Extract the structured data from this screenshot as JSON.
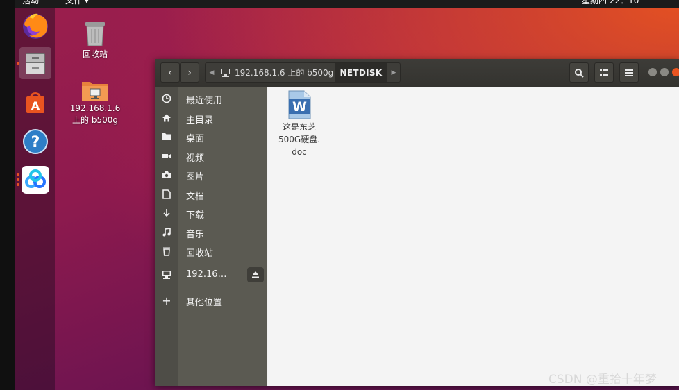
{
  "topbar": {
    "activities": "活动",
    "file_menu": "文件 ▾",
    "clock": "星期四 22：10"
  },
  "dock": {
    "items": [
      {
        "icon": "firefox-icon"
      },
      {
        "icon": "files-icon"
      },
      {
        "icon": "software-store-icon"
      },
      {
        "icon": "help-icon"
      },
      {
        "icon": "baidu-netdisk-icon"
      }
    ]
  },
  "desktop": {
    "icons": [
      {
        "label": "回收站",
        "icon": "trash-icon"
      },
      {
        "label_line1": "192.168.1.6",
        "label_line2": "上的 b500g",
        "icon": "network-folder-icon"
      }
    ]
  },
  "window": {
    "path": {
      "segment1": "192.168.1.6 上的 b500g",
      "segment2": "NETDISK"
    },
    "sidebar": {
      "items": [
        {
          "label": "最近使用",
          "icon": "recent-icon"
        },
        {
          "label": "主目录",
          "icon": "home-icon"
        },
        {
          "label": "桌面",
          "icon": "desktop-folder-icon"
        },
        {
          "label": "视频",
          "icon": "video-icon"
        },
        {
          "label": "图片",
          "icon": "camera-icon"
        },
        {
          "label": "文档",
          "icon": "document-icon"
        },
        {
          "label": "下载",
          "icon": "download-icon"
        },
        {
          "label": "音乐",
          "icon": "music-icon"
        },
        {
          "label": "回收站",
          "icon": "trash-icon"
        },
        {
          "label": "192.16…",
          "icon": "network-drive-icon"
        },
        {
          "label": "其他位置",
          "icon": "plus-icon"
        }
      ]
    },
    "files": [
      {
        "name_line1": "这是东芝",
        "name_line2": "500G硬盘.",
        "name_line3": "doc",
        "icon": "word-doc-icon"
      }
    ]
  },
  "watermark": "CSDN @重拾十年梦",
  "colors": {
    "accent": "#e95420",
    "sidebar": "#5b5a52",
    "headerbar": "#3b3a36"
  }
}
